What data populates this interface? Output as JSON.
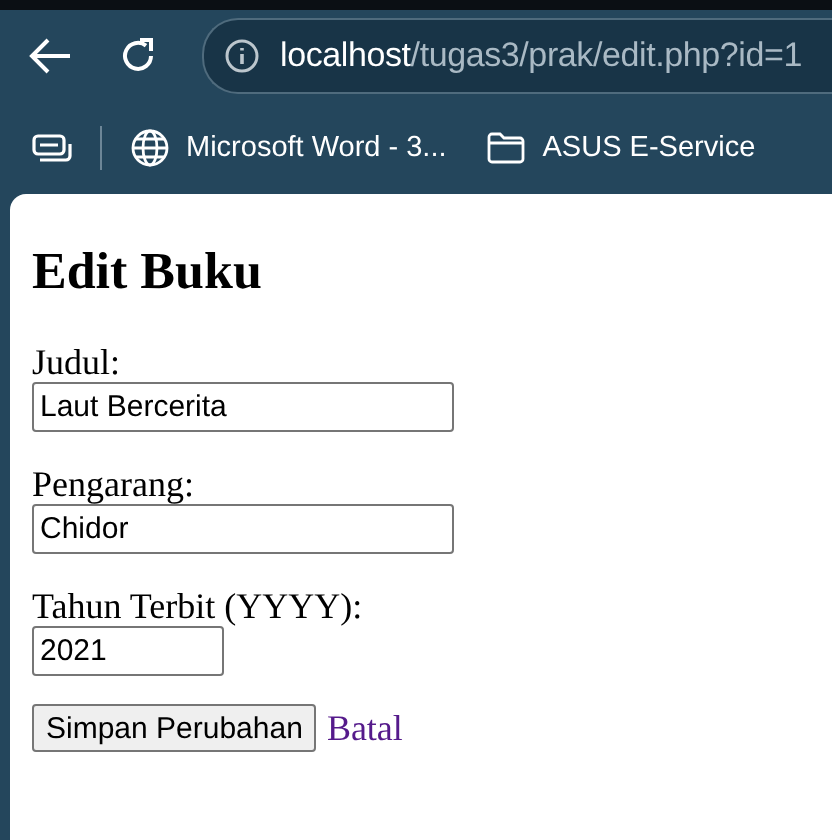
{
  "browser": {
    "url_host": "localhost",
    "url_path": "/tugas3/prak/edit.php?id=1",
    "bookmarks": [
      {
        "kind": "web",
        "label": "Microsoft Word - 3..."
      },
      {
        "kind": "folder",
        "label": "ASUS E-Service"
      }
    ]
  },
  "page": {
    "heading": "Edit Buku",
    "fields": [
      {
        "label": "Judul:",
        "value": "Laut Bercerita",
        "kind": "wide"
      },
      {
        "label": "Pengarang:",
        "value": "Chidor",
        "kind": "wide"
      },
      {
        "label": "Tahun Terbit (YYYY):",
        "value": "2021",
        "kind": "narrow"
      }
    ],
    "submit": "Simpan Perubahan",
    "cancel_link": "Batal"
  }
}
